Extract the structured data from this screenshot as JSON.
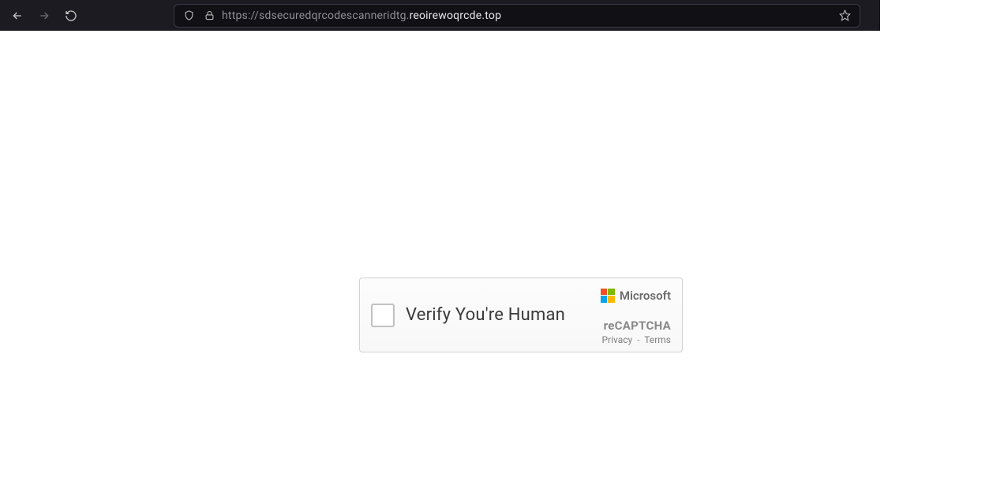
{
  "browser": {
    "url_prefix": "https://sdsecuredqrcodescanneridtg.",
    "url_highlight": "reoirewoqrcde.top"
  },
  "captcha": {
    "label": "Verify You're Human",
    "brand": "Microsoft",
    "recaptcha_label": "reCAPTCHA",
    "privacy": "Privacy",
    "terms": "Terms",
    "separator": "-"
  }
}
